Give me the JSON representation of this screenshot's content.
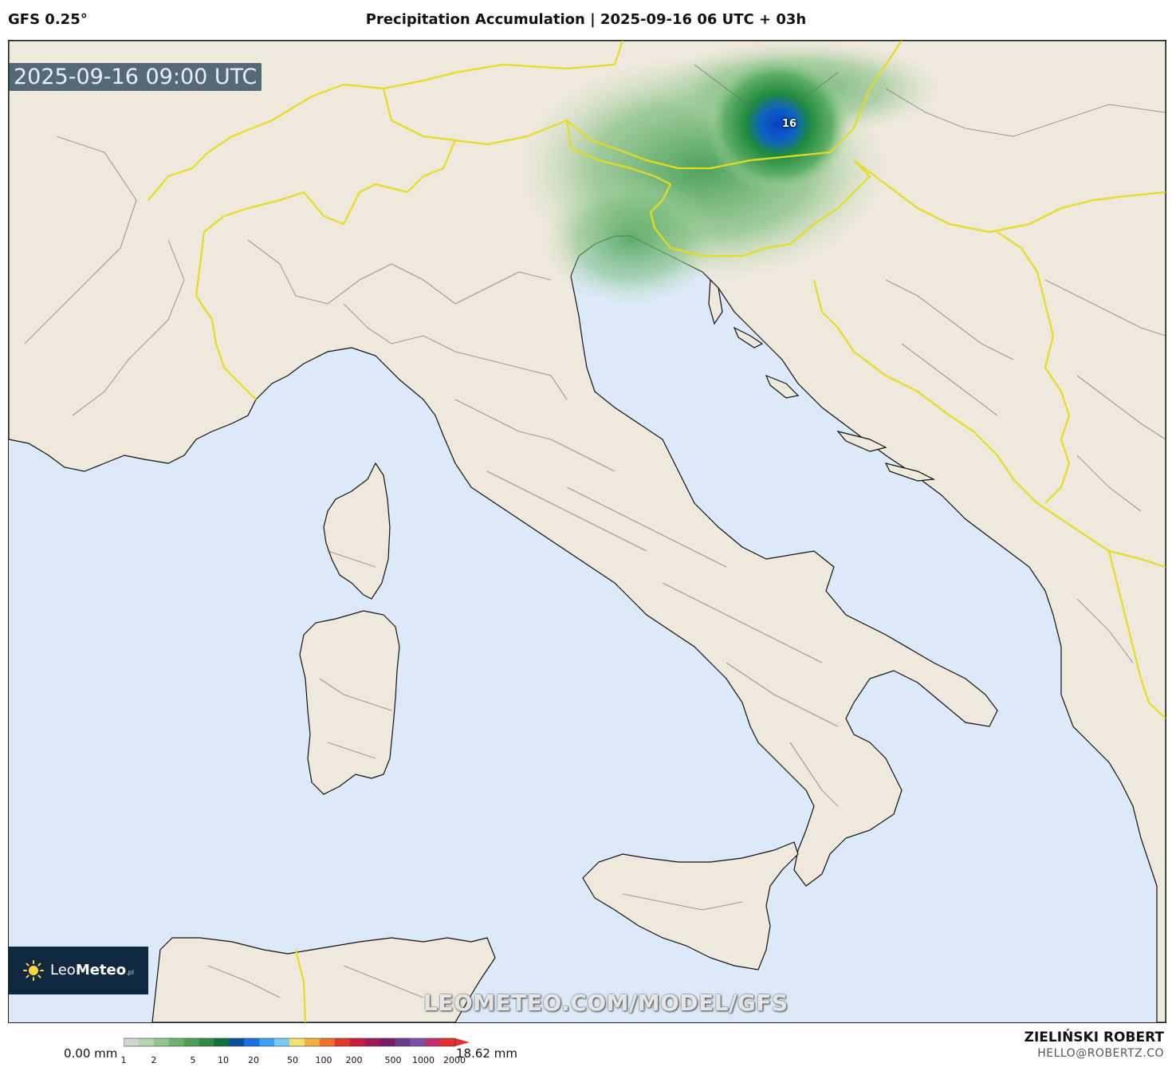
{
  "header": {
    "model": "GFS 0.25°",
    "title": "Precipitation Accumulation | 2025-09-16 06 UTC + 03h"
  },
  "map": {
    "timestamp": "2025-09-16 09:00 UTC",
    "max_value_label": "16",
    "watermark": "LEOMETEO.COM/MODEL/GFS",
    "colors": {
      "sea": "#dbe9f8",
      "land": "#efe8dc",
      "coast": "#111111",
      "country_border": "#f2ea2a",
      "admin_border": "#555555",
      "precip_light": "#a9d6a6",
      "precip_mid": "#3a9a4d",
      "precip_heavy": "#0a55c8"
    }
  },
  "logo": {
    "name_plain": "Leo",
    "name_bold": "Meteo",
    "suffix": ".pl"
  },
  "colorbar": {
    "min_label": "0.00 mm",
    "max_label": "18.62 mm",
    "ticks": [
      "1",
      "2",
      "5",
      "10",
      "20",
      "50",
      "100",
      "200",
      "500",
      "1000",
      "2000"
    ],
    "colors": [
      "#cfd8cf",
      "#b4d1b0",
      "#93c490",
      "#6fb16f",
      "#4f9f57",
      "#2e8a44",
      "#12703a",
      "#0c4f9c",
      "#1c6fe0",
      "#3aa0f2",
      "#78c9f4",
      "#f0e070",
      "#f2b040",
      "#ee7030",
      "#e03a2a",
      "#c81e3a",
      "#a01a55",
      "#7a1a6a",
      "#6c3c8c",
      "#7a50a8",
      "#c03070",
      "#e23030"
    ]
  },
  "credits": {
    "author": "ZIELIŃSKI ROBERT",
    "email": "HELLO@ROBERTZ.CO"
  }
}
